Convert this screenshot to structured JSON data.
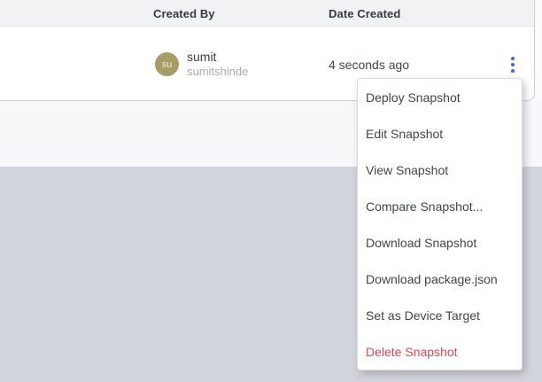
{
  "table": {
    "columns": {
      "created_by": "Created By",
      "date_created": "Date Created"
    },
    "row": {
      "avatar_initials": "su",
      "avatar_color": "#a59c66",
      "user_name": "sumit",
      "user_handle": "sumitshinde",
      "date_created": "4 seconds ago"
    },
    "kebab_icon": "kebab-menu-vertical-dots",
    "kebab_color": "#3a68dd"
  },
  "menu": {
    "danger_color": "#dc4651",
    "items": [
      {
        "label": "Deploy Snapshot"
      },
      {
        "label": "Edit Snapshot"
      },
      {
        "label": "View Snapshot"
      },
      {
        "label": "Compare Snapshot..."
      },
      {
        "label": "Download Snapshot"
      },
      {
        "label": "Download package.json"
      },
      {
        "label": "Set as Device Target"
      },
      {
        "label": "Delete Snapshot"
      }
    ]
  }
}
